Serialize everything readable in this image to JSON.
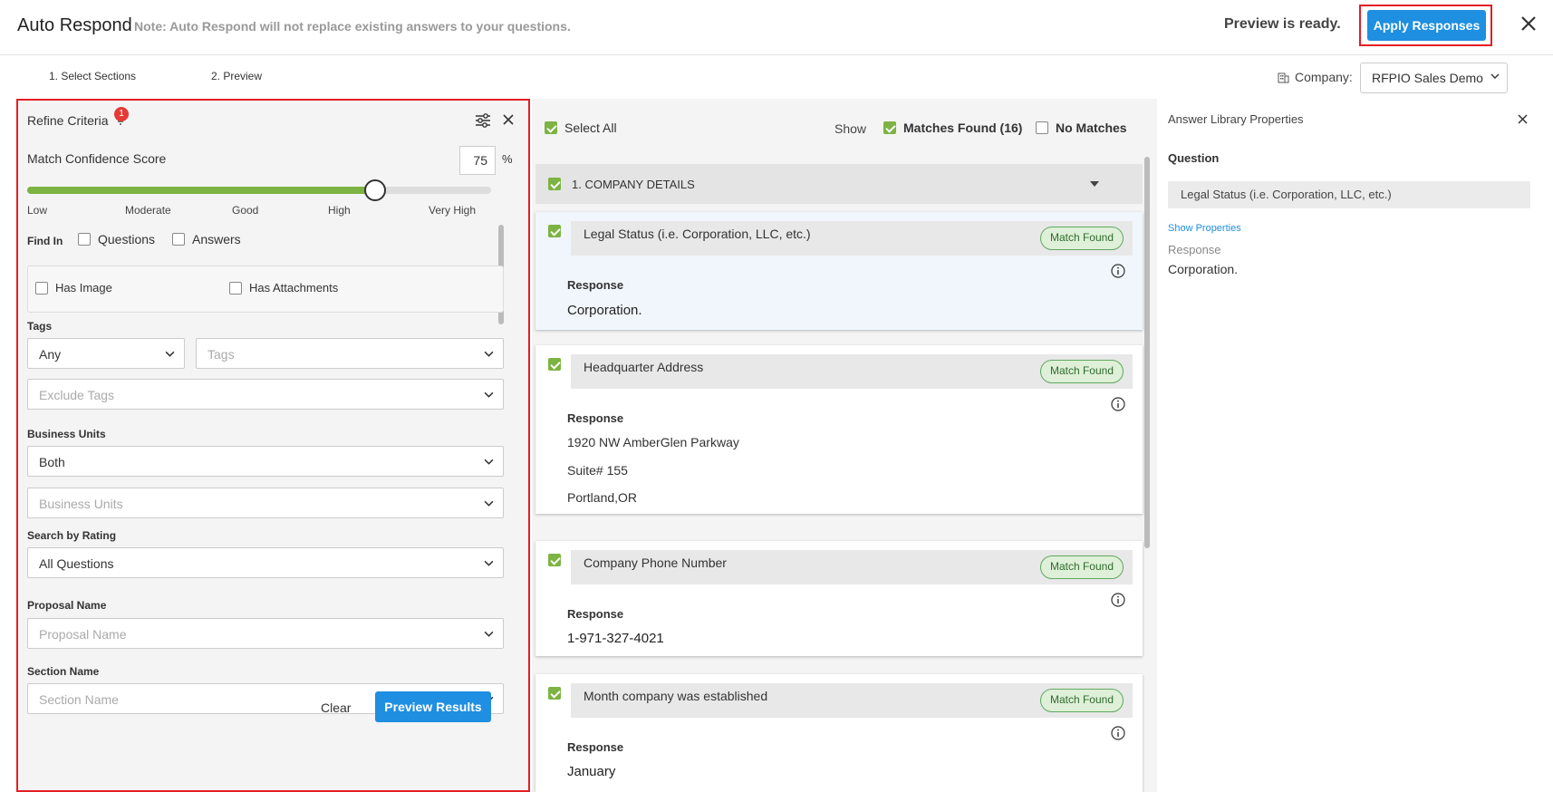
{
  "header": {
    "title": "Auto Respond",
    "note": "Note: Auto Respond will not replace existing answers to your questions.",
    "status": "Preview is ready.",
    "apply_label": "Apply Responses",
    "close_icon": "close-icon"
  },
  "steps": [
    "1. Select Sections",
    "2. Preview"
  ],
  "company": {
    "label": "Company:",
    "value": "RFPIO Sales Demo",
    "icon": "building-icon"
  },
  "refine": {
    "title": "Refine Criteria",
    "badge": "1",
    "confidence_label": "Match Confidence Score",
    "confidence_value": "75",
    "confidence_unit": "%",
    "confidence_fraction": 0.75,
    "scale": [
      "Low",
      "Moderate",
      "Good",
      "High",
      "Very High"
    ],
    "find_in_label": "Find In",
    "find_in_options": [
      "Questions",
      "Answers"
    ],
    "extra_options": [
      "Has Image",
      "Has Attachments"
    ],
    "tags_label": "Tags",
    "tags_mode": "Any",
    "tags_placeholder": "Tags",
    "exclude_tags_placeholder": "Exclude Tags",
    "business_units_label": "Business Units",
    "business_units_value": "Both",
    "business_units_placeholder": "Business Units",
    "rating_label": "Search by Rating",
    "rating_value": "All Questions",
    "proposal_label": "Proposal Name",
    "proposal_placeholder": "Proposal Name",
    "section_label": "Section Name",
    "section_placeholder": "Section Name",
    "clear_label": "Clear",
    "preview_label": "Preview Results"
  },
  "results": {
    "select_all": "Select All",
    "show_label": "Show",
    "matches_found": "Matches Found (16)",
    "no_matches": "No Matches",
    "section_title": "1. COMPANY DETAILS",
    "match_badge": "Match Found",
    "response_label": "Response",
    "cards": [
      {
        "question": "Legal Status (i.e. Corporation, LLC, etc.)",
        "response": [
          "Corporation."
        ]
      },
      {
        "question": "Headquarter Address",
        "response": [
          "1920 NW AmberGlen Parkway",
          "Suite# 155",
          "Portland,OR"
        ]
      },
      {
        "question": "Company Phone Number",
        "response": [
          "1-971-327-4021"
        ]
      },
      {
        "question": "Month company was established",
        "response": [
          "January"
        ]
      }
    ]
  },
  "properties": {
    "title": "Answer Library Properties",
    "question_label": "Question",
    "question": "Legal Status (i.e. Corporation, LLC, etc.)",
    "show_properties": "Show Properties",
    "response_label": "Response",
    "response": "Corporation."
  },
  "colors": {
    "accent": "#1e8fe1",
    "highlight": "#e31e24",
    "check": "#7cb342",
    "match": "#dff0d8"
  }
}
